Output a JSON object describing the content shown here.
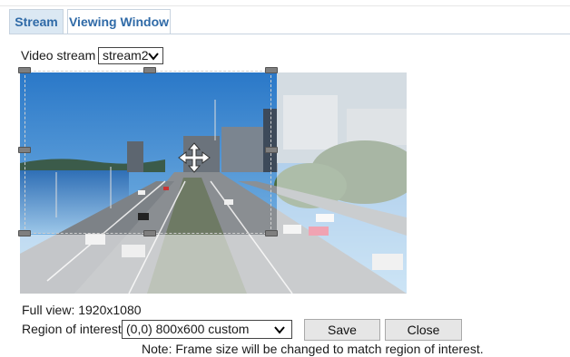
{
  "tabs": [
    {
      "label": "Stream"
    },
    {
      "label": "Viewing Window"
    }
  ],
  "video_stream": {
    "label": "Video stream :",
    "value": "stream2"
  },
  "viewer": {
    "full_view": "Full view: 1920x1080"
  },
  "region": {
    "label": "Region of interest :",
    "value": "(0,0) 800x600 custom"
  },
  "buttons": {
    "save": "Save",
    "close": "Close"
  },
  "note": "Note: Frame size will be changed to match region of interest.",
  "colors": {
    "tab_text": "#2f6aa7",
    "tab_active_bg": "#dbe8f3",
    "border": "#c7d3df"
  }
}
